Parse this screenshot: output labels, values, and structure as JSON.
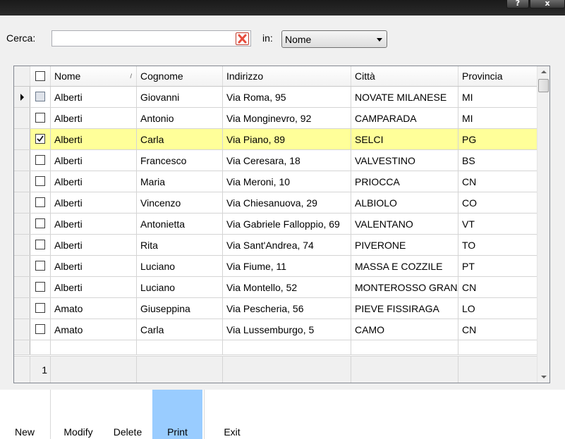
{
  "titlebar": {
    "help_glyph": "?",
    "close_glyph": "x"
  },
  "search": {
    "label": "Cerca:",
    "value": "",
    "placeholder": "",
    "in_label": "in:",
    "field_selected": "Nome"
  },
  "grid": {
    "columns": [
      "Nome",
      "Cognome",
      "Indirizzo",
      "Città",
      "Provincia"
    ],
    "rows": [
      {
        "nome": "Alberti",
        "cognome": "Giovanni",
        "indirizzo": "Via Roma, 95",
        "citta": "NOVATE MILANESE",
        "provincia": "MI",
        "checked": false,
        "current": true
      },
      {
        "nome": "Alberti",
        "cognome": "Antonio",
        "indirizzo": "Via Monginevro, 92",
        "citta": "CAMPARADA",
        "provincia": "MI",
        "checked": false
      },
      {
        "nome": "Alberti",
        "cognome": "Carla",
        "indirizzo": "Via Piano, 89",
        "citta": "SELCI",
        "provincia": "PG",
        "checked": true,
        "selected": true
      },
      {
        "nome": "Alberti",
        "cognome": "Francesco",
        "indirizzo": "Via Ceresara, 18",
        "citta": "VALVESTINO",
        "provincia": "BS",
        "checked": false
      },
      {
        "nome": "Alberti",
        "cognome": "Maria",
        "indirizzo": "Via Meroni, 10",
        "citta": "PRIOCCA",
        "provincia": "CN",
        "checked": false
      },
      {
        "nome": "Alberti",
        "cognome": "Vincenzo",
        "indirizzo": "Via Chiesanuova, 29",
        "citta": "ALBIOLO",
        "provincia": "CO",
        "checked": false
      },
      {
        "nome": "Alberti",
        "cognome": "Antonietta",
        "indirizzo": "Via Gabriele Falloppio, 69",
        "citta": "VALENTANO",
        "provincia": "VT",
        "checked": false
      },
      {
        "nome": "Alberti",
        "cognome": "Rita",
        "indirizzo": "Via Sant'Andrea, 74",
        "citta": "PIVERONE",
        "provincia": "TO",
        "checked": false
      },
      {
        "nome": "Alberti",
        "cognome": "Luciano",
        "indirizzo": "Via Fiume, 11",
        "citta": "MASSA E COZZILE",
        "provincia": "PT",
        "checked": false
      },
      {
        "nome": "Alberti",
        "cognome": "Luciano",
        "indirizzo": "Via Montello, 52",
        "citta": "MONTEROSSO GRANA",
        "provincia": "CN",
        "checked": false
      },
      {
        "nome": "Amato",
        "cognome": "Giuseppina",
        "indirizzo": "Via Pescheria, 56",
        "citta": "PIEVE FISSIRAGA",
        "provincia": "LO",
        "checked": false
      },
      {
        "nome": "Amato",
        "cognome": "Carla",
        "indirizzo": "Via Lussemburgo, 5",
        "citta": "CAMO",
        "provincia": "CN",
        "checked": false
      }
    ],
    "footer_count": "1",
    "sort_glyph": "/"
  },
  "toolbar": {
    "new_label": "New",
    "modify_label": "Modify",
    "delete_label": "Delete",
    "print_label": "Print",
    "exit_label": "Exit"
  },
  "colors": {
    "selected_row": "#ffff99",
    "active_button": "#99ccff",
    "clear_icon": "#e74c3c"
  }
}
